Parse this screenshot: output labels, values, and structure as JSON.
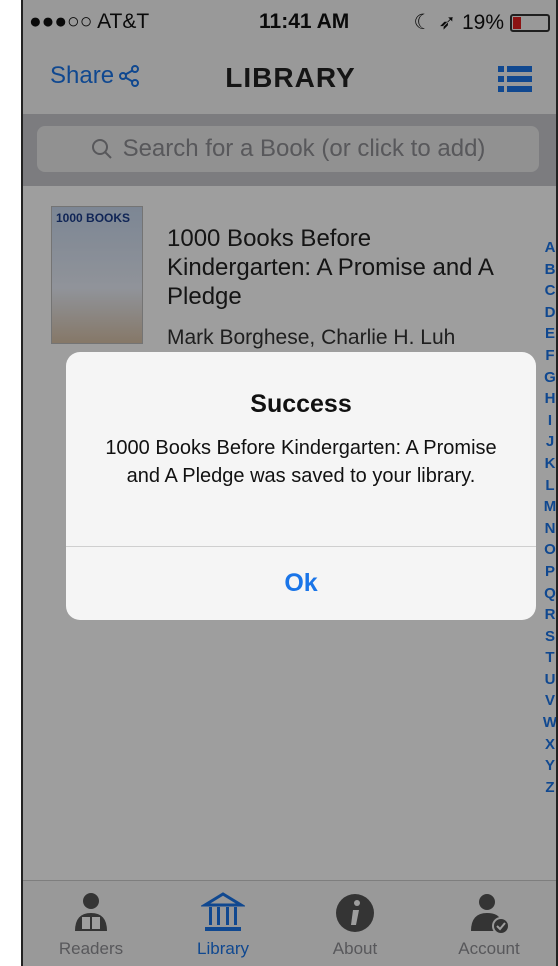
{
  "status": {
    "carrier": "●●●○○ AT&T",
    "time": "11:41 AM",
    "battery": "19%"
  },
  "nav": {
    "share_label": "Share",
    "title": "LIBRARY"
  },
  "search": {
    "placeholder": "Search for a Book (or click to add)"
  },
  "books": [
    {
      "cover_text": "1000 BOOKS",
      "title": "1000 Books Before Kindergarten: A Promise and A Pledge",
      "author": "Mark Borghese, Charlie H. Luh"
    }
  ],
  "index_letters": [
    "A",
    "B",
    "C",
    "D",
    "E",
    "F",
    "G",
    "H",
    "I",
    "J",
    "K",
    "L",
    "M",
    "N",
    "O",
    "P",
    "Q",
    "R",
    "S",
    "T",
    "U",
    "V",
    "W",
    "X",
    "Y",
    "Z"
  ],
  "alert": {
    "title": "Success",
    "message": "1000 Books Before Kindergarten: A Promise and A Pledge was saved to your library.",
    "ok_label": "Ok"
  },
  "tabs": [
    {
      "label": "Readers",
      "icon": "readers-icon"
    },
    {
      "label": "Library",
      "icon": "library-icon"
    },
    {
      "label": "About",
      "icon": "info-icon"
    },
    {
      "label": "Account",
      "icon": "account-icon"
    }
  ],
  "colors": {
    "accent": "#1a75e8",
    "battery_low": "#e02020"
  }
}
